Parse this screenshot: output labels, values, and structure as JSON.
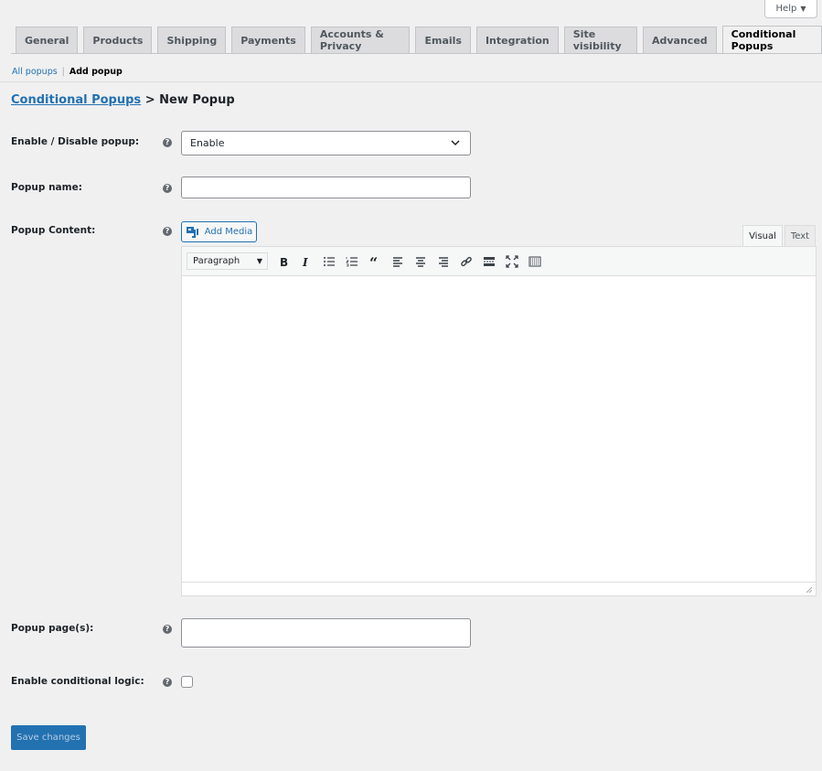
{
  "help": {
    "label": "Help"
  },
  "tabs": [
    {
      "label": "General",
      "active": false
    },
    {
      "label": "Products",
      "active": false
    },
    {
      "label": "Shipping",
      "active": false
    },
    {
      "label": "Payments",
      "active": false
    },
    {
      "label": "Accounts & Privacy",
      "active": false
    },
    {
      "label": "Emails",
      "active": false
    },
    {
      "label": "Integration",
      "active": false
    },
    {
      "label": "Site visibility",
      "active": false
    },
    {
      "label": "Advanced",
      "active": false
    },
    {
      "label": "Conditional Popups",
      "active": true
    }
  ],
  "subnav": {
    "all_popups": "All popups",
    "separator": "|",
    "add_popup": "Add popup"
  },
  "title": {
    "link": "Conditional Popups",
    "rest": " > New Popup"
  },
  "form": {
    "enable": {
      "label": "Enable / Disable popup:",
      "value": "Enable"
    },
    "name": {
      "label": "Popup name:",
      "value": ""
    },
    "content": {
      "label": "Popup Content:",
      "add_media": "Add Media",
      "visual_tab": "Visual",
      "text_tab": "Text",
      "format": "Paragraph"
    },
    "pages": {
      "label": "Popup page(s):",
      "value": ""
    },
    "conditional": {
      "label": "Enable conditional logic:",
      "checked": false
    }
  },
  "help_tip": "?",
  "save": {
    "label": "Save changes"
  },
  "colors": {
    "accent": "#2271b1",
    "background": "#f0f0f1"
  }
}
